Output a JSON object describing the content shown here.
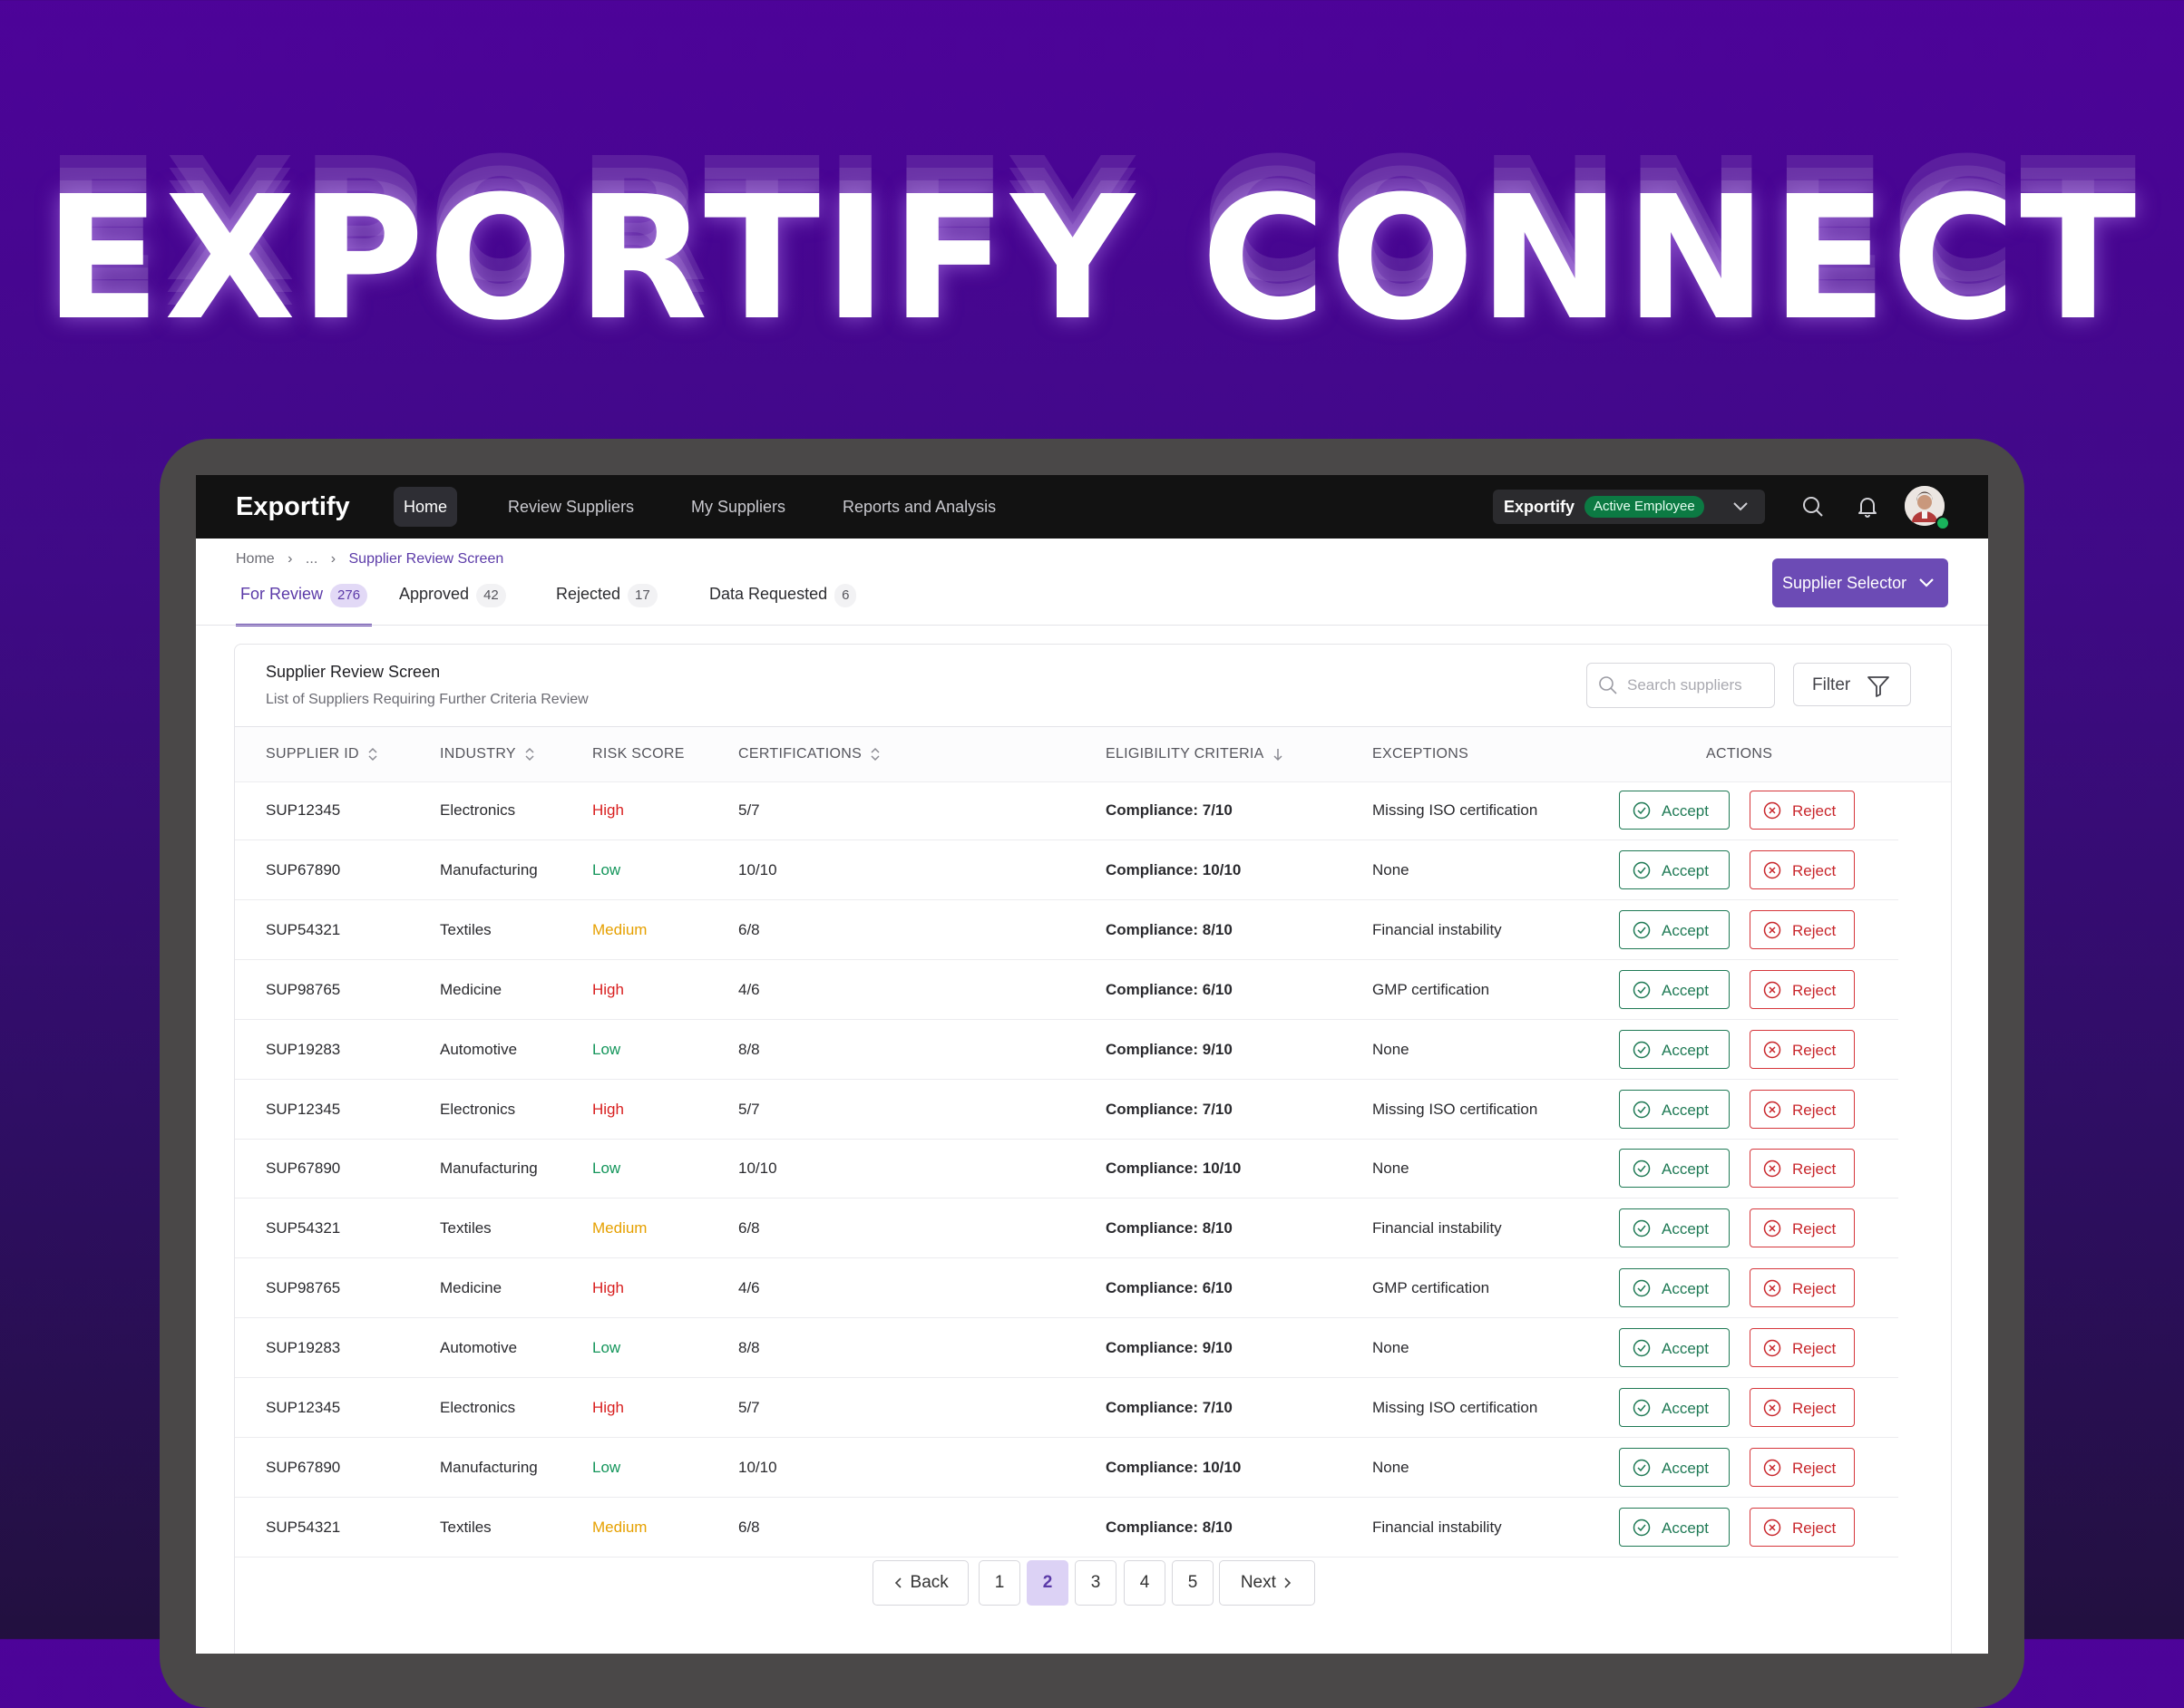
{
  "hero": {
    "title": "EXPORTIFY CONNECT"
  },
  "navbar": {
    "logo": "Exportify",
    "items": [
      {
        "label": "Home",
        "active": true
      },
      {
        "label": "Review Suppliers"
      },
      {
        "label": "My Suppliers"
      },
      {
        "label": "Reports and Analysis"
      }
    ],
    "account": {
      "name": "Exportify",
      "status": "Active Employee"
    },
    "icons": [
      "search-icon",
      "bell-icon",
      "chevron-down-icon"
    ]
  },
  "breadcrumb": [
    "Home",
    "›",
    "...",
    "›",
    "Supplier Review Screen"
  ],
  "tabs": [
    {
      "label": "For Review",
      "count": "276",
      "active": true
    },
    {
      "label": "Approved",
      "count": "42"
    },
    {
      "label": "Rejected",
      "count": "17"
    },
    {
      "label": "Data Requested",
      "count": "6"
    }
  ],
  "supplier_selector": "Supplier Selector",
  "card": {
    "title": "Supplier Review Screen",
    "subtitle": "List of Suppliers Requiring Further Criteria Review",
    "search_placeholder": "Search suppliers",
    "filter_label": "Filter"
  },
  "table": {
    "columns": [
      "SUPPLIER ID",
      "INDUSTRY",
      "RISK SCORE",
      "CERTIFICATIONS",
      "ELIGIBILITY CRITERIA",
      "EXCEPTIONS",
      "ACTIONS"
    ],
    "accept_label": "Accept",
    "reject_label": "Reject",
    "rows": [
      [
        "SUP12345",
        "Electronics",
        "High",
        "5/7",
        "Compliance: 7/10",
        "Missing ISO certification"
      ],
      [
        "SUP67890",
        "Manufacturing",
        "Low",
        "10/10",
        "Compliance: 10/10",
        "None"
      ],
      [
        "SUP54321",
        "Textiles",
        "Medium",
        "6/8",
        "Compliance: 8/10",
        "Financial instability"
      ],
      [
        "SUP98765",
        "Medicine",
        "High",
        "4/6",
        "Compliance: 6/10",
        "GMP certification"
      ],
      [
        "SUP19283",
        "Automotive",
        "Low",
        "8/8",
        "Compliance: 9/10",
        "None"
      ],
      [
        "SUP12345",
        "Electronics",
        "High",
        "5/7",
        "Compliance: 7/10",
        "Missing ISO certification"
      ],
      [
        "SUP67890",
        "Manufacturing",
        "Low",
        "10/10",
        "Compliance: 10/10",
        "None"
      ],
      [
        "SUP54321",
        "Textiles",
        "Medium",
        "6/8",
        "Compliance: 8/10",
        "Financial instability"
      ],
      [
        "SUP98765",
        "Medicine",
        "High",
        "4/6",
        "Compliance: 6/10",
        "GMP certification"
      ],
      [
        "SUP19283",
        "Automotive",
        "Low",
        "8/8",
        "Compliance: 9/10",
        "None"
      ],
      [
        "SUP12345",
        "Electronics",
        "High",
        "5/7",
        "Compliance: 7/10",
        "Missing ISO certification"
      ],
      [
        "SUP67890",
        "Manufacturing",
        "Low",
        "10/10",
        "Compliance: 10/10",
        "None"
      ],
      [
        "SUP54321",
        "Textiles",
        "Medium",
        "6/8",
        "Compliance: 8/10",
        "Financial instability"
      ]
    ]
  },
  "pagination": {
    "back": "Back",
    "next": "Next",
    "pages": [
      "1",
      "2",
      "3",
      "4",
      "5"
    ],
    "current": "2"
  },
  "colors": {
    "accent": "#6c4bb5",
    "risk_high": "#d81e1e",
    "risk_low": "#13955a",
    "risk_medium": "#e6a000"
  }
}
